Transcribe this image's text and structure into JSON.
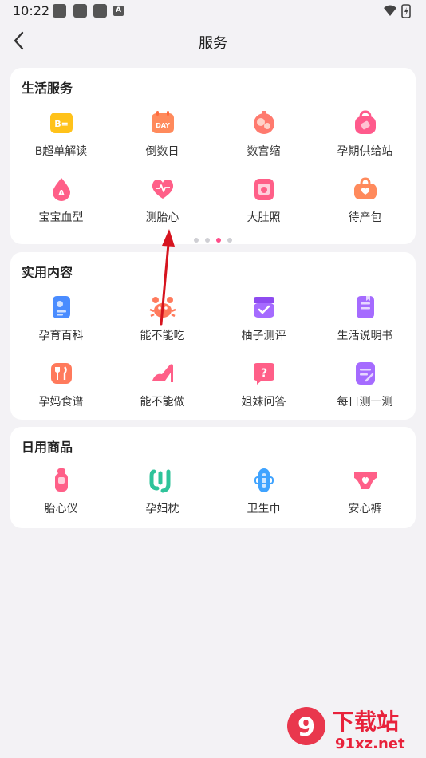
{
  "status": {
    "time": "10:22",
    "notif_letter": "A"
  },
  "nav": {
    "title": "服务"
  },
  "sections": [
    {
      "title": "生活服务",
      "items": [
        {
          "label": "B超单解读",
          "icon": "ultrasound-report-icon",
          "icon_text": "B=",
          "color": "#ffc21a"
        },
        {
          "label": "倒数日",
          "icon": "countdown-calendar-icon",
          "icon_text": "DAY",
          "color": "#ff8a5c"
        },
        {
          "label": "数宫缩",
          "icon": "contraction-timer-icon",
          "icon_text": "",
          "color": "#ff7a6e"
        },
        {
          "label": "孕期供给站",
          "icon": "pregnancy-supply-bag-icon",
          "icon_text": "",
          "color": "#ff5a8c"
        },
        {
          "label": "宝宝血型",
          "icon": "blood-type-drop-icon",
          "icon_text": "A",
          "color": "#ff5f88"
        },
        {
          "label": "测胎心",
          "icon": "fetal-heartbeat-icon",
          "icon_text": "",
          "color": "#ff5f88"
        },
        {
          "label": "大肚照",
          "icon": "belly-photo-icon",
          "icon_text": "",
          "color": "#ff5f88"
        },
        {
          "label": "待产包",
          "icon": "hospital-bag-icon",
          "icon_text": "",
          "color": "#ff8a5c"
        }
      ],
      "pager": {
        "count": 4,
        "active": 2
      }
    },
    {
      "title": "实用内容",
      "items": [
        {
          "label": "孕育百科",
          "icon": "encyclopedia-icon",
          "icon_text": "",
          "color": "#4a8cff"
        },
        {
          "label": "能不能吃",
          "icon": "crab-food-icon",
          "icon_text": "",
          "color": "#ff7a5c"
        },
        {
          "label": "柚子测评",
          "icon": "review-box-icon",
          "icon_text": "",
          "color": "#a56bff"
        },
        {
          "label": "生活说明书",
          "icon": "manual-book-icon",
          "icon_text": "",
          "color": "#a56bff"
        },
        {
          "label": "孕妈食谱",
          "icon": "recipe-utensils-icon",
          "icon_text": "",
          "color": "#ff7a5c"
        },
        {
          "label": "能不能做",
          "icon": "high-heel-icon",
          "icon_text": "",
          "color": "#ff5f88"
        },
        {
          "label": "姐妹问答",
          "icon": "qa-bubble-icon",
          "icon_text": "?",
          "color": "#ff5f88"
        },
        {
          "label": "每日测一测",
          "icon": "daily-quiz-icon",
          "icon_text": "",
          "color": "#a56bff"
        }
      ]
    },
    {
      "title": "日用商品",
      "items": [
        {
          "label": "胎心仪",
          "icon": "fetal-doppler-icon",
          "icon_text": "",
          "color": "#ff5f88"
        },
        {
          "label": "孕妇枕",
          "icon": "pregnancy-pillow-icon",
          "icon_text": "",
          "color": "#2fc39a"
        },
        {
          "label": "卫生巾",
          "icon": "sanitary-pad-icon",
          "icon_text": "",
          "color": "#3fa3ff"
        },
        {
          "label": "安心裤",
          "icon": "maternity-pants-icon",
          "icon_text": "",
          "color": "#ff5f88"
        }
      ]
    }
  ],
  "watermark": {
    "brand": "下载站",
    "domain": "91xz.net",
    "logo_num": "9"
  },
  "accent": "#ff4d8a"
}
